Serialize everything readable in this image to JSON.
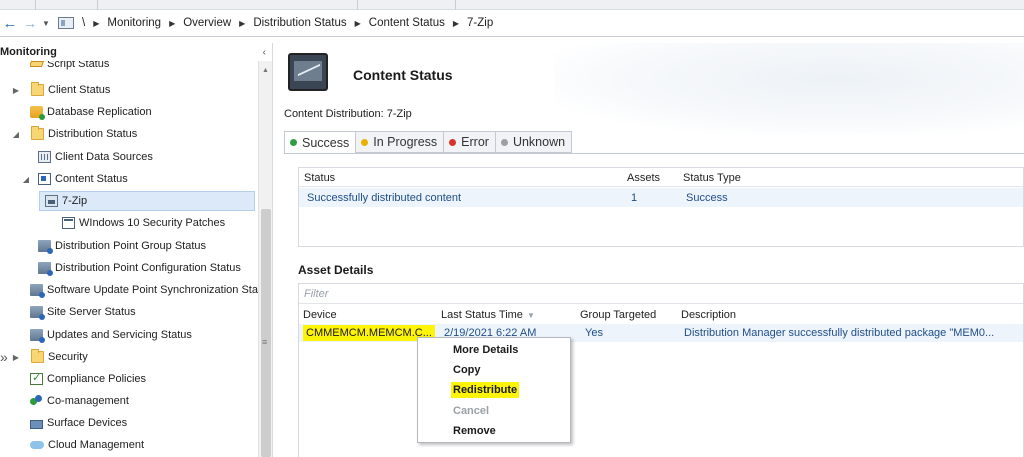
{
  "breadcrumb": [
    "\\",
    "Monitoring",
    "Overview",
    "Distribution Status",
    "Content Status",
    "7-Zip"
  ],
  "nav": {
    "title": "Monitoring",
    "items": [
      {
        "label": "Script Status",
        "icon": "script-icon"
      },
      {
        "label": "Client Status",
        "icon": "folder-icon"
      },
      {
        "label": "Database Replication",
        "icon": "database-icon"
      },
      {
        "label": "Distribution Status",
        "icon": "folder-icon"
      },
      {
        "label": "Client Data Sources",
        "icon": "grid-icon"
      },
      {
        "label": "Content Status",
        "icon": "document-icon"
      },
      {
        "label": "7-Zip",
        "icon": "package-icon"
      },
      {
        "label": "WIndows 10 Security Patches",
        "icon": "window-icon"
      },
      {
        "label": "Distribution Point Group Status",
        "icon": "server-icon"
      },
      {
        "label": "Distribution Point Configuration Status",
        "icon": "server-icon"
      },
      {
        "label": "Software Update Point Synchronization Sta",
        "icon": "server-icon"
      },
      {
        "label": "Site Server Status",
        "icon": "server-icon"
      },
      {
        "label": "Updates and Servicing Status",
        "icon": "server-icon"
      },
      {
        "label": "Security",
        "icon": "folder-icon"
      },
      {
        "label": "Compliance Policies",
        "icon": "checklist-icon"
      },
      {
        "label": "Co-management",
        "icon": "comanagement-icon"
      },
      {
        "label": "Surface Devices",
        "icon": "surface-icon"
      },
      {
        "label": "Cloud Management",
        "icon": "cloud-icon"
      }
    ]
  },
  "main": {
    "title": "Content Status",
    "distribution_label": "Content Distribution: 7-Zip",
    "tabs": [
      {
        "label": "Success",
        "color": "#2ea043"
      },
      {
        "label": "In Progress",
        "color": "#e8b100"
      },
      {
        "label": "Error",
        "color": "#d9342b"
      },
      {
        "label": "Unknown",
        "color": "#9aa0a6"
      }
    ],
    "status_table": {
      "headers": [
        "Status",
        "Assets",
        "Status Type"
      ],
      "rows": [
        [
          "Successfully distributed content",
          "1",
          "Success"
        ]
      ]
    },
    "asset_details": {
      "title": "Asset Details",
      "filter_placeholder": "Filter",
      "headers": [
        "Device",
        "Last Status Time",
        "Group Targeted",
        "Description"
      ],
      "rows": [
        [
          "CMMEMCM.MEMCM.C...",
          "2/19/2021 6:22 AM",
          "Yes",
          "Distribution Manager successfully distributed package \"MEM0..."
        ]
      ]
    }
  },
  "context_menu": {
    "items": [
      "More Details",
      "Copy",
      "Redistribute",
      "Cancel",
      "Remove"
    ]
  },
  "colors": {
    "highlight": "#fdf40a",
    "selection": "#dbe9f8",
    "link_text": "#1f4e8a"
  }
}
